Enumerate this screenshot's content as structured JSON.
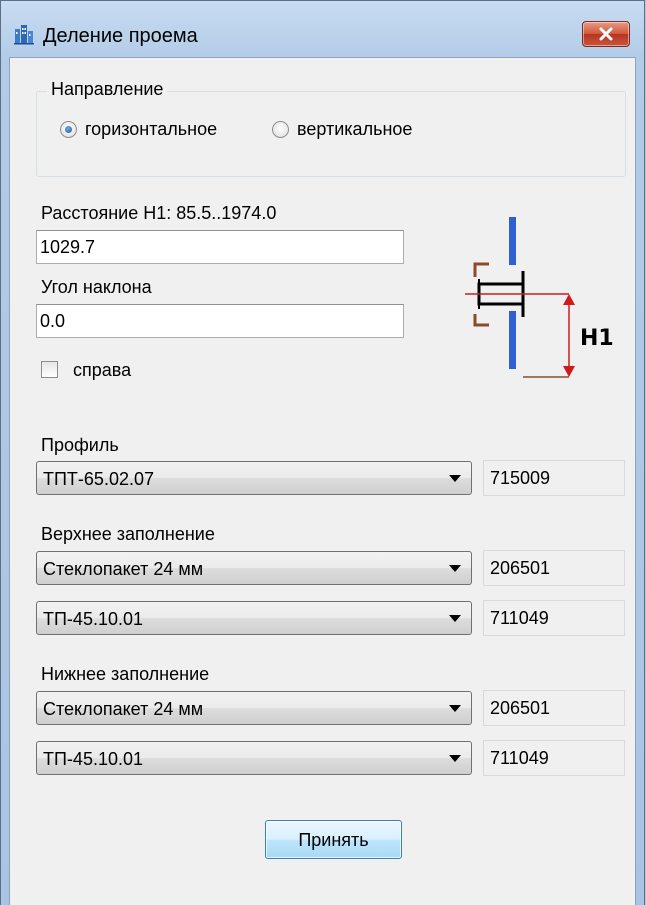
{
  "window": {
    "title": "Деление проема",
    "icon": "building-icon",
    "close_icon": "close-icon"
  },
  "direction": {
    "legend": "Направление",
    "options": [
      {
        "label": "горизонтальное",
        "checked": true
      },
      {
        "label": "вертикальное",
        "checked": false
      }
    ]
  },
  "distance": {
    "label": "Расстояние Н1: 85.5..1974.0",
    "value": "1029.7"
  },
  "angle": {
    "label": "Угол наклона",
    "value": "0.0"
  },
  "right_checkbox": {
    "label": "справа",
    "checked": false
  },
  "diagram": {
    "label": "H1"
  },
  "profile": {
    "label": "Профиль",
    "selected": "ТПТ-65.02.07",
    "code": "715009"
  },
  "upper_fill": {
    "label": "Верхнее заполнение",
    "glass_selected": "Стеклопакет 24 мм",
    "glass_code": "206501",
    "profile_selected": "ТП-45.10.01",
    "profile_code": "711049"
  },
  "lower_fill": {
    "label": "Нижнее заполнение",
    "glass_selected": "Стеклопакет 24 мм",
    "glass_code": "206501",
    "profile_selected": "ТП-45.10.01",
    "profile_code": "711049"
  },
  "buttons": {
    "accept": "Принять"
  },
  "colors": {
    "glass_blue": "#2f5fd0",
    "frame_brown": "#8b4a2b",
    "dimension_red": "#d11a1a",
    "button_border": "#3c7fb1"
  }
}
